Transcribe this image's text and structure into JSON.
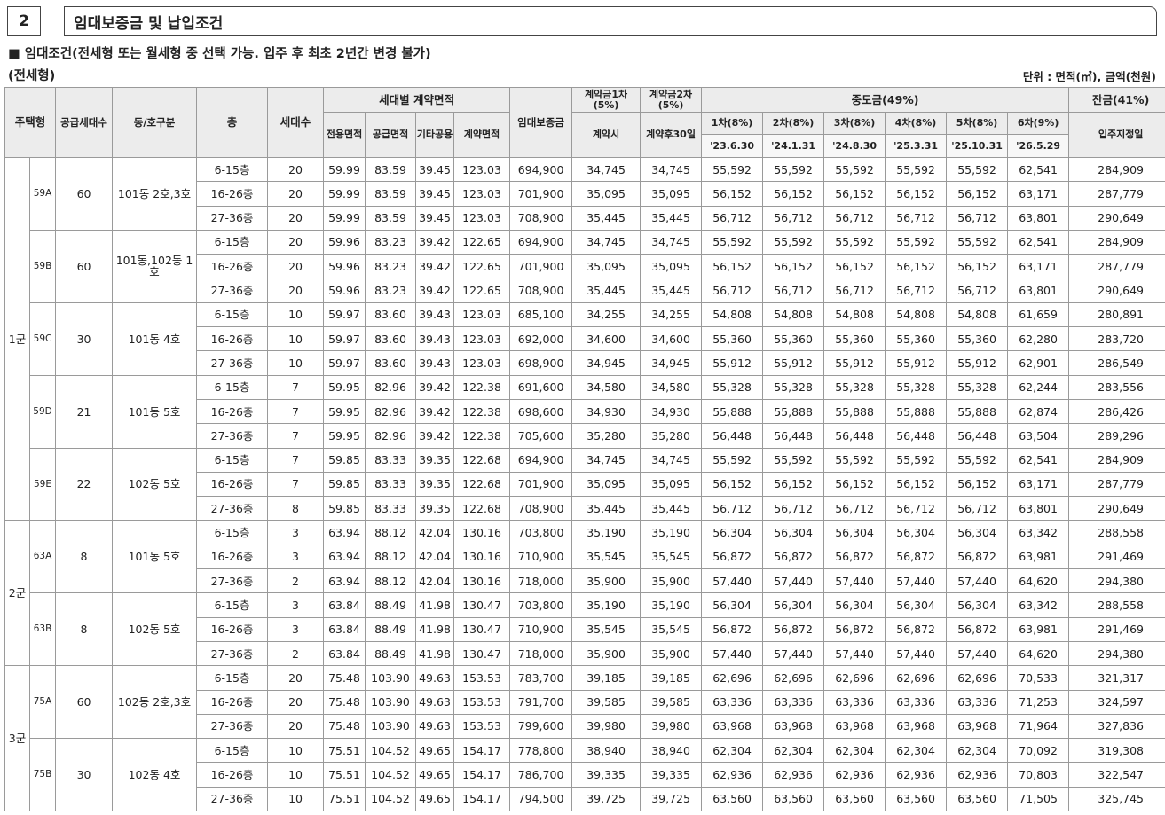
{
  "section": {
    "number": "2",
    "title": "임대보증금 및 납입조건"
  },
  "condition_text": "■ 임대조건(전세형 또는 월세형 중 선택 가능. 입주 후 최초 2년간 변경 불가)",
  "type_label": "(전세형)",
  "unit_text": "단위 : 면적(㎡), 금액(천원)",
  "headers": {
    "housing_type": "주택형",
    "supply_units": "공급세대수",
    "dong_ho": "동/호구분",
    "floor": "층",
    "units": "세대수",
    "area_group": "세대별 계약면적",
    "exclusive": "전용면적",
    "supply": "공급면적",
    "other_common": "기타공용",
    "contract_area": "계약면적",
    "deposit": "임대보증금",
    "down1": "계약금1차(5%)",
    "down1_when": "계약시",
    "down2": "계약금2차(5%)",
    "down2_when": "계약후30일",
    "mid_group": "중도금(49%)",
    "mid": [
      {
        "label": "1차(8%)",
        "date": "'23.6.30"
      },
      {
        "label": "2차(8%)",
        "date": "'24.1.31"
      },
      {
        "label": "3차(8%)",
        "date": "'24.8.30"
      },
      {
        "label": "4차(8%)",
        "date": "'25.3.31"
      },
      {
        "label": "5차(8%)",
        "date": "'25.10.31"
      },
      {
        "label": "6차(9%)",
        "date": "'26.5.29"
      }
    ],
    "balance": "잔금(41%)",
    "balance_when": "입주지정일"
  },
  "groups": [
    {
      "name": "1군",
      "types": [
        {
          "type": "59A",
          "supply": "60",
          "dong": "101동 2호,3호",
          "rows": [
            [
              "6-15층",
              "20",
              "59.99",
              "83.59",
              "39.45",
              "123.03",
              "694,900",
              "34,745",
              "34,745",
              "55,592",
              "55,592",
              "55,592",
              "55,592",
              "55,592",
              "62,541",
              "284,909"
            ],
            [
              "16-26층",
              "20",
              "59.99",
              "83.59",
              "39.45",
              "123.03",
              "701,900",
              "35,095",
              "35,095",
              "56,152",
              "56,152",
              "56,152",
              "56,152",
              "56,152",
              "63,171",
              "287,779"
            ],
            [
              "27-36층",
              "20",
              "59.99",
              "83.59",
              "39.45",
              "123.03",
              "708,900",
              "35,445",
              "35,445",
              "56,712",
              "56,712",
              "56,712",
              "56,712",
              "56,712",
              "63,801",
              "290,649"
            ]
          ]
        },
        {
          "type": "59B",
          "supply": "60",
          "dong": "101동,102동 1호",
          "rows": [
            [
              "6-15층",
              "20",
              "59.96",
              "83.23",
              "39.42",
              "122.65",
              "694,900",
              "34,745",
              "34,745",
              "55,592",
              "55,592",
              "55,592",
              "55,592",
              "55,592",
              "62,541",
              "284,909"
            ],
            [
              "16-26층",
              "20",
              "59.96",
              "83.23",
              "39.42",
              "122.65",
              "701,900",
              "35,095",
              "35,095",
              "56,152",
              "56,152",
              "56,152",
              "56,152",
              "56,152",
              "63,171",
              "287,779"
            ],
            [
              "27-36층",
              "20",
              "59.96",
              "83.23",
              "39.42",
              "122.65",
              "708,900",
              "35,445",
              "35,445",
              "56,712",
              "56,712",
              "56,712",
              "56,712",
              "56,712",
              "63,801",
              "290,649"
            ]
          ]
        },
        {
          "type": "59C",
          "supply": "30",
          "dong": "101동 4호",
          "rows": [
            [
              "6-15층",
              "10",
              "59.97",
              "83.60",
              "39.43",
              "123.03",
              "685,100",
              "34,255",
              "34,255",
              "54,808",
              "54,808",
              "54,808",
              "54,808",
              "54,808",
              "61,659",
              "280,891"
            ],
            [
              "16-26층",
              "10",
              "59.97",
              "83.60",
              "39.43",
              "123.03",
              "692,000",
              "34,600",
              "34,600",
              "55,360",
              "55,360",
              "55,360",
              "55,360",
              "55,360",
              "62,280",
              "283,720"
            ],
            [
              "27-36층",
              "10",
              "59.97",
              "83.60",
              "39.43",
              "123.03",
              "698,900",
              "34,945",
              "34,945",
              "55,912",
              "55,912",
              "55,912",
              "55,912",
              "55,912",
              "62,901",
              "286,549"
            ]
          ]
        },
        {
          "type": "59D",
          "supply": "21",
          "dong": "101동 5호",
          "rows": [
            [
              "6-15층",
              "7",
              "59.95",
              "82.96",
              "39.42",
              "122.38",
              "691,600",
              "34,580",
              "34,580",
              "55,328",
              "55,328",
              "55,328",
              "55,328",
              "55,328",
              "62,244",
              "283,556"
            ],
            [
              "16-26층",
              "7",
              "59.95",
              "82.96",
              "39.42",
              "122.38",
              "698,600",
              "34,930",
              "34,930",
              "55,888",
              "55,888",
              "55,888",
              "55,888",
              "55,888",
              "62,874",
              "286,426"
            ],
            [
              "27-36층",
              "7",
              "59.95",
              "82.96",
              "39.42",
              "122.38",
              "705,600",
              "35,280",
              "35,280",
              "56,448",
              "56,448",
              "56,448",
              "56,448",
              "56,448",
              "63,504",
              "289,296"
            ]
          ]
        },
        {
          "type": "59E",
          "supply": "22",
          "dong": "102동 5호",
          "rows": [
            [
              "6-15층",
              "7",
              "59.85",
              "83.33",
              "39.35",
              "122.68",
              "694,900",
              "34,745",
              "34,745",
              "55,592",
              "55,592",
              "55,592",
              "55,592",
              "55,592",
              "62,541",
              "284,909"
            ],
            [
              "16-26층",
              "7",
              "59.85",
              "83.33",
              "39.35",
              "122.68",
              "701,900",
              "35,095",
              "35,095",
              "56,152",
              "56,152",
              "56,152",
              "56,152",
              "56,152",
              "63,171",
              "287,779"
            ],
            [
              "27-36층",
              "8",
              "59.85",
              "83.33",
              "39.35",
              "122.68",
              "708,900",
              "35,445",
              "35,445",
              "56,712",
              "56,712",
              "56,712",
              "56,712",
              "56,712",
              "63,801",
              "290,649"
            ]
          ]
        }
      ]
    },
    {
      "name": "2군",
      "types": [
        {
          "type": "63A",
          "supply": "8",
          "dong": "101동 5호",
          "rows": [
            [
              "6-15층",
              "3",
              "63.94",
              "88.12",
              "42.04",
              "130.16",
              "703,800",
              "35,190",
              "35,190",
              "56,304",
              "56,304",
              "56,304",
              "56,304",
              "56,304",
              "63,342",
              "288,558"
            ],
            [
              "16-26층",
              "3",
              "63.94",
              "88.12",
              "42.04",
              "130.16",
              "710,900",
              "35,545",
              "35,545",
              "56,872",
              "56,872",
              "56,872",
              "56,872",
              "56,872",
              "63,981",
              "291,469"
            ],
            [
              "27-36층",
              "2",
              "63.94",
              "88.12",
              "42.04",
              "130.16",
              "718,000",
              "35,900",
              "35,900",
              "57,440",
              "57,440",
              "57,440",
              "57,440",
              "57,440",
              "64,620",
              "294,380"
            ]
          ]
        },
        {
          "type": "63B",
          "supply": "8",
          "dong": "102동 5호",
          "rows": [
            [
              "6-15층",
              "3",
              "63.84",
              "88.49",
              "41.98",
              "130.47",
              "703,800",
              "35,190",
              "35,190",
              "56,304",
              "56,304",
              "56,304",
              "56,304",
              "56,304",
              "63,342",
              "288,558"
            ],
            [
              "16-26층",
              "3",
              "63.84",
              "88.49",
              "41.98",
              "130.47",
              "710,900",
              "35,545",
              "35,545",
              "56,872",
              "56,872",
              "56,872",
              "56,872",
              "56,872",
              "63,981",
              "291,469"
            ],
            [
              "27-36층",
              "2",
              "63.84",
              "88.49",
              "41.98",
              "130.47",
              "718,000",
              "35,900",
              "35,900",
              "57,440",
              "57,440",
              "57,440",
              "57,440",
              "57,440",
              "64,620",
              "294,380"
            ]
          ]
        }
      ]
    },
    {
      "name": "3군",
      "types": [
        {
          "type": "75A",
          "supply": "60",
          "dong": "102동 2호,3호",
          "rows": [
            [
              "6-15층",
              "20",
              "75.48",
              "103.90",
              "49.63",
              "153.53",
              "783,700",
              "39,185",
              "39,185",
              "62,696",
              "62,696",
              "62,696",
              "62,696",
              "62,696",
              "70,533",
              "321,317"
            ],
            [
              "16-26층",
              "20",
              "75.48",
              "103.90",
              "49.63",
              "153.53",
              "791,700",
              "39,585",
              "39,585",
              "63,336",
              "63,336",
              "63,336",
              "63,336",
              "63,336",
              "71,253",
              "324,597"
            ],
            [
              "27-36층",
              "20",
              "75.48",
              "103.90",
              "49.63",
              "153.53",
              "799,600",
              "39,980",
              "39,980",
              "63,968",
              "63,968",
              "63,968",
              "63,968",
              "63,968",
              "71,964",
              "327,836"
            ]
          ]
        },
        {
          "type": "75B",
          "supply": "30",
          "dong": "102동 4호",
          "rows": [
            [
              "6-15층",
              "10",
              "75.51",
              "104.52",
              "49.65",
              "154.17",
              "778,800",
              "38,940",
              "38,940",
              "62,304",
              "62,304",
              "62,304",
              "62,304",
              "62,304",
              "70,092",
              "319,308"
            ],
            [
              "16-26층",
              "10",
              "75.51",
              "104.52",
              "49.65",
              "154.17",
              "786,700",
              "39,335",
              "39,335",
              "62,936",
              "62,936",
              "62,936",
              "62,936",
              "62,936",
              "70,803",
              "322,547"
            ],
            [
              "27-36층",
              "10",
              "75.51",
              "104.52",
              "49.65",
              "154.17",
              "794,500",
              "39,725",
              "39,725",
              "63,560",
              "63,560",
              "63,560",
              "63,560",
              "63,560",
              "71,505",
              "325,745"
            ]
          ]
        }
      ]
    }
  ]
}
